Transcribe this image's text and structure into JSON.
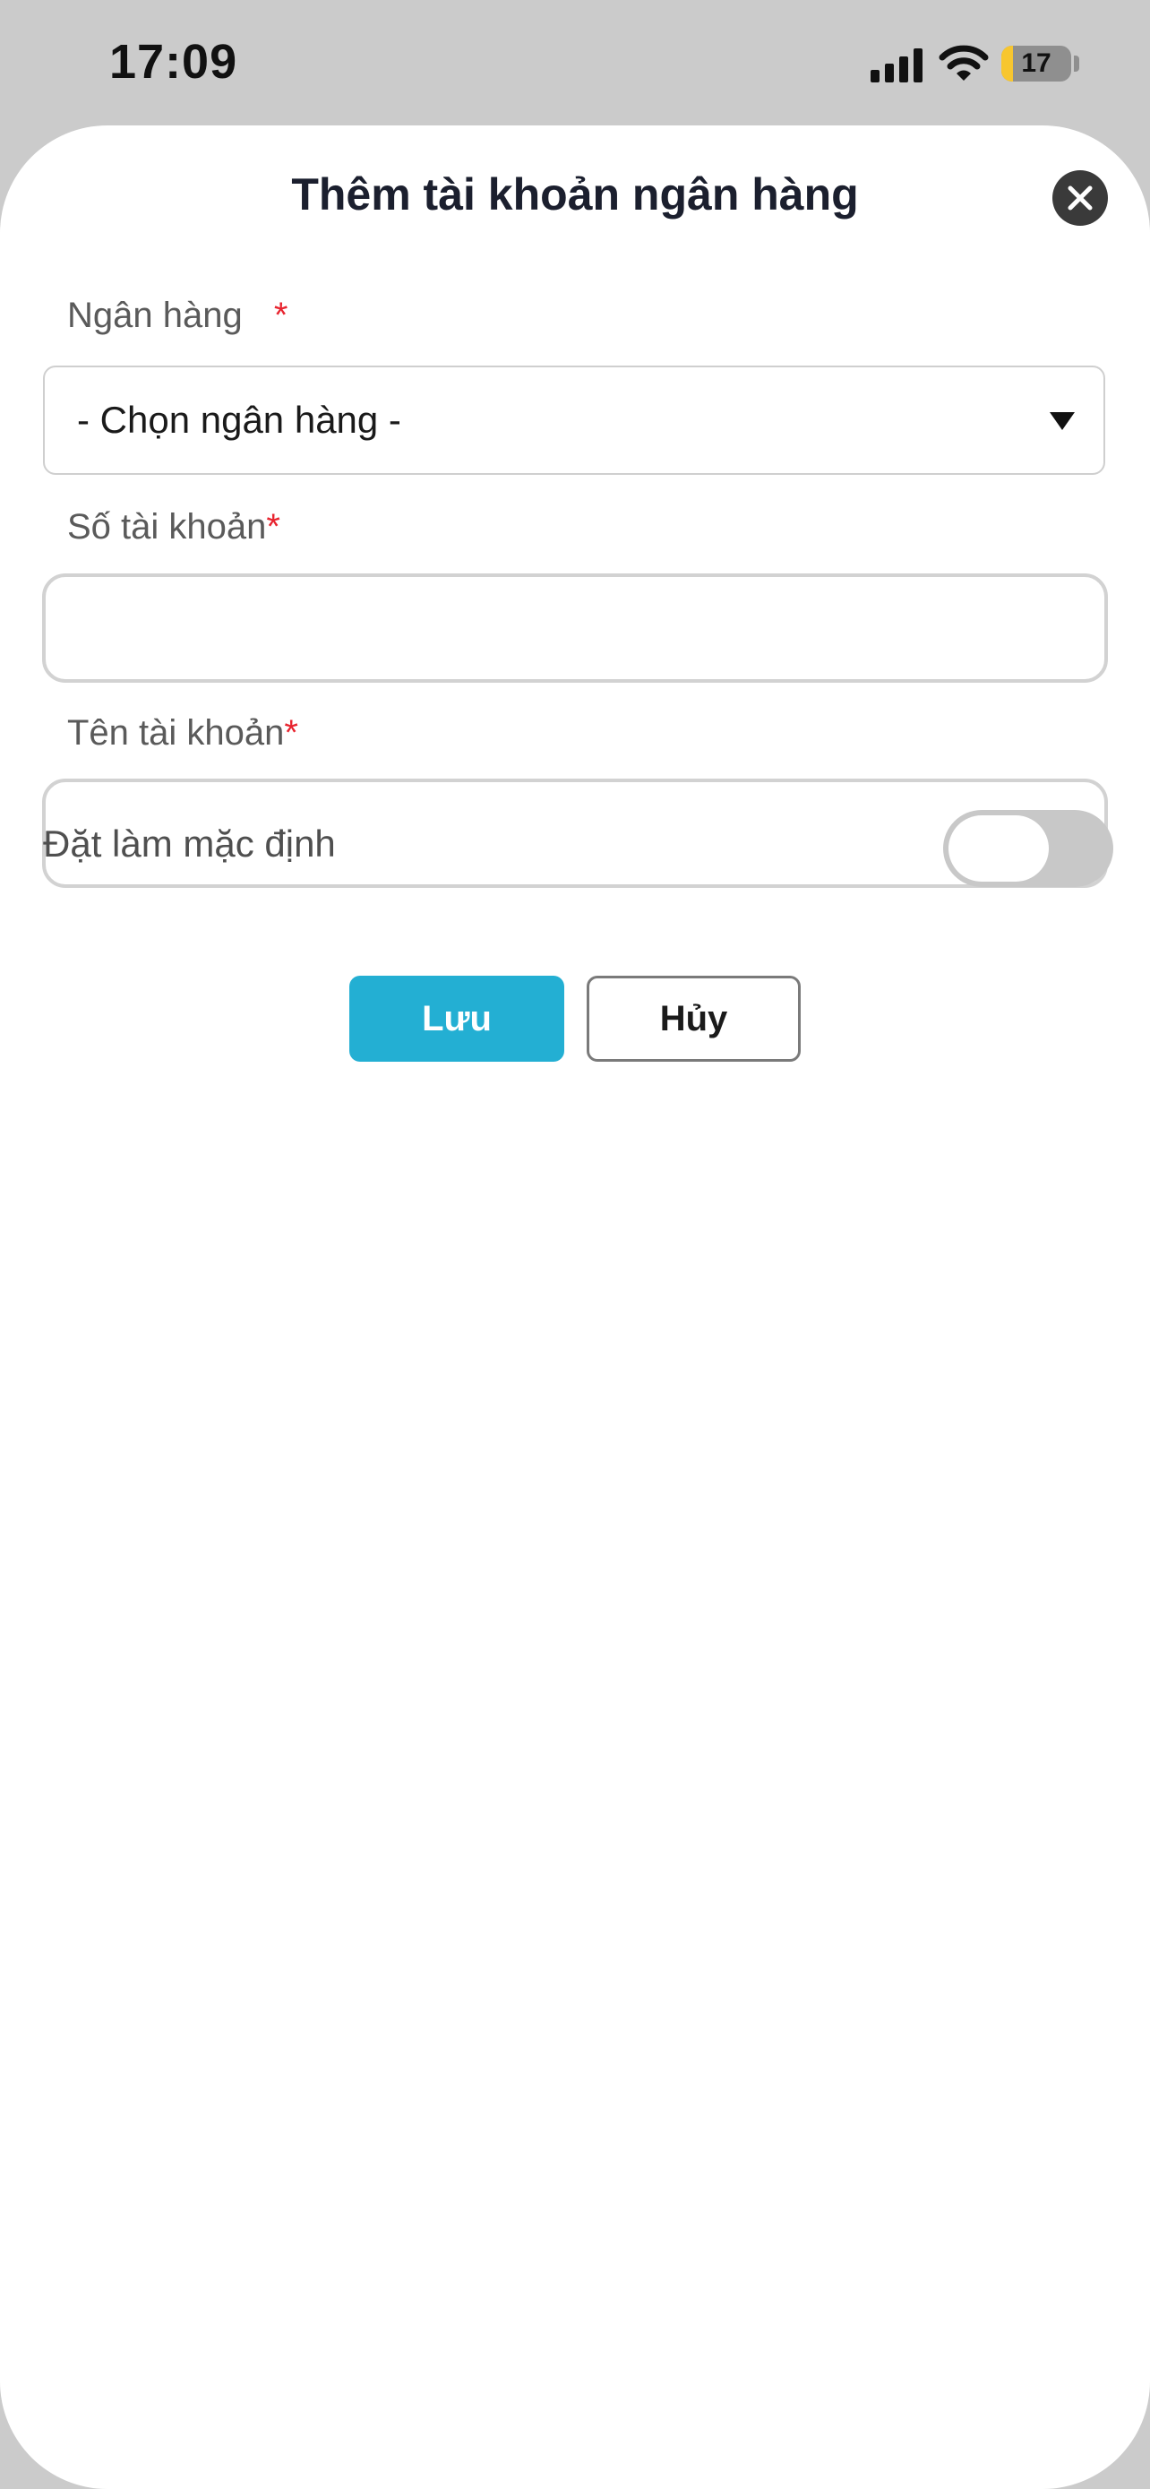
{
  "status_bar": {
    "time": "17:09",
    "battery_level": "17",
    "battery_fraction": 0.17,
    "icons": [
      "signal-icon",
      "wifi-icon",
      "battery-icon"
    ]
  },
  "sheet": {
    "title": "Thêm tài khoản ngân hàng",
    "close_icon": "close-icon"
  },
  "form": {
    "bank": {
      "label": "Ngân hàng",
      "required": "*",
      "selected_value": "- Chọn ngân hàng -"
    },
    "account_number": {
      "label": "Số tài khoản",
      "required": "*",
      "value": "",
      "placeholder": ""
    },
    "account_name": {
      "label": "Tên tài khoản",
      "required": "*",
      "value": "",
      "placeholder": ""
    },
    "set_default": {
      "label": "Đặt làm mặc định",
      "checked": false
    }
  },
  "actions": {
    "save_label": "Lưu",
    "cancel_label": "Hủy"
  },
  "colors": {
    "accent": "#23afd3",
    "required": "#e8242f",
    "toggle_off": "#c8c8c8",
    "battery_fill": "#f7c62f"
  }
}
